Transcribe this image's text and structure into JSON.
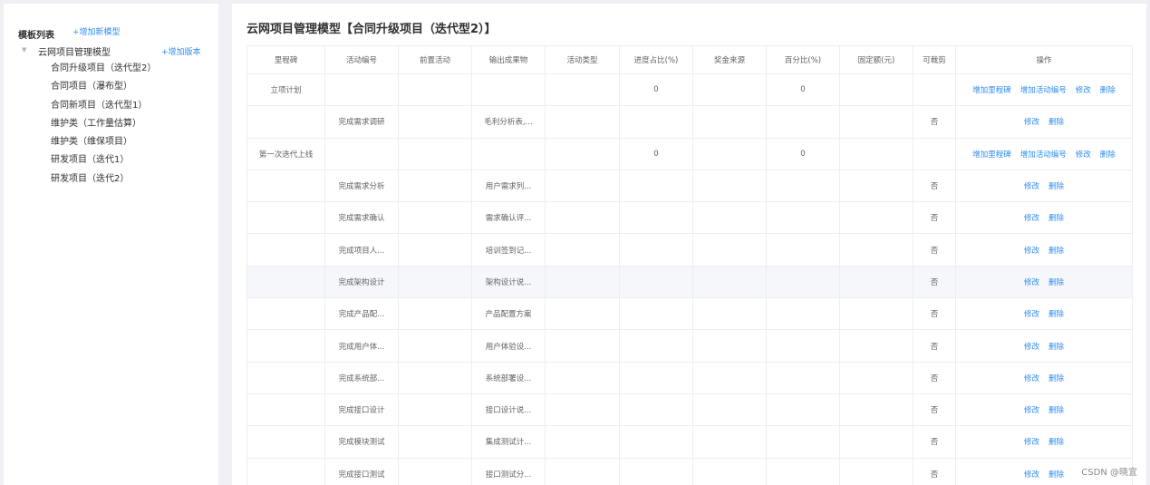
{
  "sidebar": {
    "title": "模板列表",
    "add_model_label": "+增加新模型",
    "tree": {
      "root_label": "云网项目管理模型",
      "add_version_label": "+增加版本",
      "children": [
        "合同升级项目（迭代型2）",
        "合同项目（瀑布型）",
        "合同新项目（迭代型1）",
        "维护类（工作量估算）",
        "维护类（维保项目）",
        "研发项目（迭代1）",
        "研发项目（迭代2）"
      ]
    }
  },
  "main": {
    "title": "云网项目管理模型【合同升级项目（迭代型2）】",
    "table": {
      "headers": [
        "里程碑",
        "活动编号",
        "前置活动",
        "输出成果物",
        "活动类型",
        "进度占比(%)",
        "奖金来源",
        "百分比(%)",
        "固定额(元)",
        "可裁剪",
        "操作"
      ],
      "rows": [
        {
          "cells": [
            "立项计划",
            "",
            "",
            "",
            "",
            "0",
            "",
            "0",
            "",
            ""
          ],
          "ops": [
            "增加里程碑",
            "增加活动编号",
            "修改",
            "删除"
          ]
        },
        {
          "cells": [
            "",
            "完成需求调研",
            "",
            "毛利分析表,...",
            "",
            "",
            "",
            "",
            "",
            "否"
          ],
          "ops": [
            "修改",
            "删除"
          ]
        },
        {
          "cells": [
            "第一次迭代上线",
            "",
            "",
            "",
            "",
            "0",
            "",
            "0",
            "",
            ""
          ],
          "ops": [
            "增加里程碑",
            "增加活动编号",
            "修改",
            "删除"
          ]
        },
        {
          "cells": [
            "",
            "完成需求分析",
            "",
            "用户需求列...",
            "",
            "",
            "",
            "",
            "",
            "否"
          ],
          "ops": [
            "修改",
            "删除"
          ]
        },
        {
          "cells": [
            "",
            "完成需求确认",
            "",
            "需求确认评...",
            "",
            "",
            "",
            "",
            "",
            "否"
          ],
          "ops": [
            "修改",
            "删除"
          ]
        },
        {
          "cells": [
            "",
            "完成项目人...",
            "",
            "培训签到记...",
            "",
            "",
            "",
            "",
            "",
            "否"
          ],
          "ops": [
            "修改",
            "删除"
          ]
        },
        {
          "cells": [
            "",
            "完成架构设计",
            "",
            "架构设计说...",
            "",
            "",
            "",
            "",
            "",
            "否"
          ],
          "ops": [
            "修改",
            "删除"
          ],
          "highlight": true
        },
        {
          "cells": [
            "",
            "完成产品配...",
            "",
            "产品配置方案",
            "",
            "",
            "",
            "",
            "",
            "否"
          ],
          "ops": [
            "修改",
            "删除"
          ]
        },
        {
          "cells": [
            "",
            "完成用户体...",
            "",
            "用户体验设...",
            "",
            "",
            "",
            "",
            "",
            "否"
          ],
          "ops": [
            "修改",
            "删除"
          ]
        },
        {
          "cells": [
            "",
            "完成系统部...",
            "",
            "系统部署设...",
            "",
            "",
            "",
            "",
            "",
            "否"
          ],
          "ops": [
            "修改",
            "删除"
          ]
        },
        {
          "cells": [
            "",
            "完成接口设计",
            "",
            "接口设计说...",
            "",
            "",
            "",
            "",
            "",
            "否"
          ],
          "ops": [
            "修改",
            "删除"
          ]
        },
        {
          "cells": [
            "",
            "完成模块测试",
            "",
            "集成测试计...",
            "",
            "",
            "",
            "",
            "",
            "否"
          ],
          "ops": [
            "修改",
            "删除"
          ]
        },
        {
          "cells": [
            "",
            "完成接口测试",
            "",
            "接口测试分...",
            "",
            "",
            "",
            "",
            "",
            "否"
          ],
          "ops": [
            "修改",
            "删除"
          ]
        }
      ]
    }
  },
  "watermark": "CSDN @晓宜",
  "colors": {
    "link": "#2d8cf0",
    "background": "#eef0f4"
  },
  "icons": {
    "tree_caret": "caret-down-icon"
  }
}
